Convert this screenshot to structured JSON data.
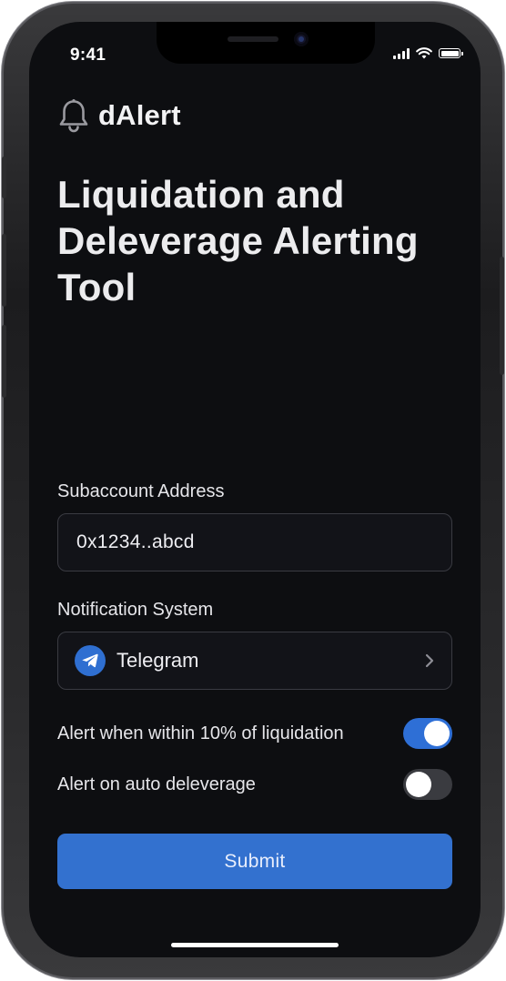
{
  "status_bar": {
    "time": "9:41",
    "icons": [
      "cellular-signal-icon",
      "wifi-icon",
      "battery-icon"
    ]
  },
  "brand": {
    "icon": "bell-icon",
    "name": "dAlert"
  },
  "page": {
    "title": "Liquidation and Deleverage Alerting Tool"
  },
  "form": {
    "address_label": "Subaccount Address",
    "address_value": "0x1234..abcd",
    "notification_label": "Notification System",
    "notification_value": "Telegram",
    "notification_icon": "telegram-icon",
    "alerts": [
      {
        "label": "Alert when within 10% of liquidation",
        "enabled": true
      },
      {
        "label": "Alert on auto deleverage",
        "enabled": false
      }
    ],
    "submit_label": "Submit"
  },
  "colors": {
    "background": "#0d0e11",
    "accent": "#3371cf",
    "toggle_off": "#3a3b40",
    "field_border": "#3a3b42"
  }
}
